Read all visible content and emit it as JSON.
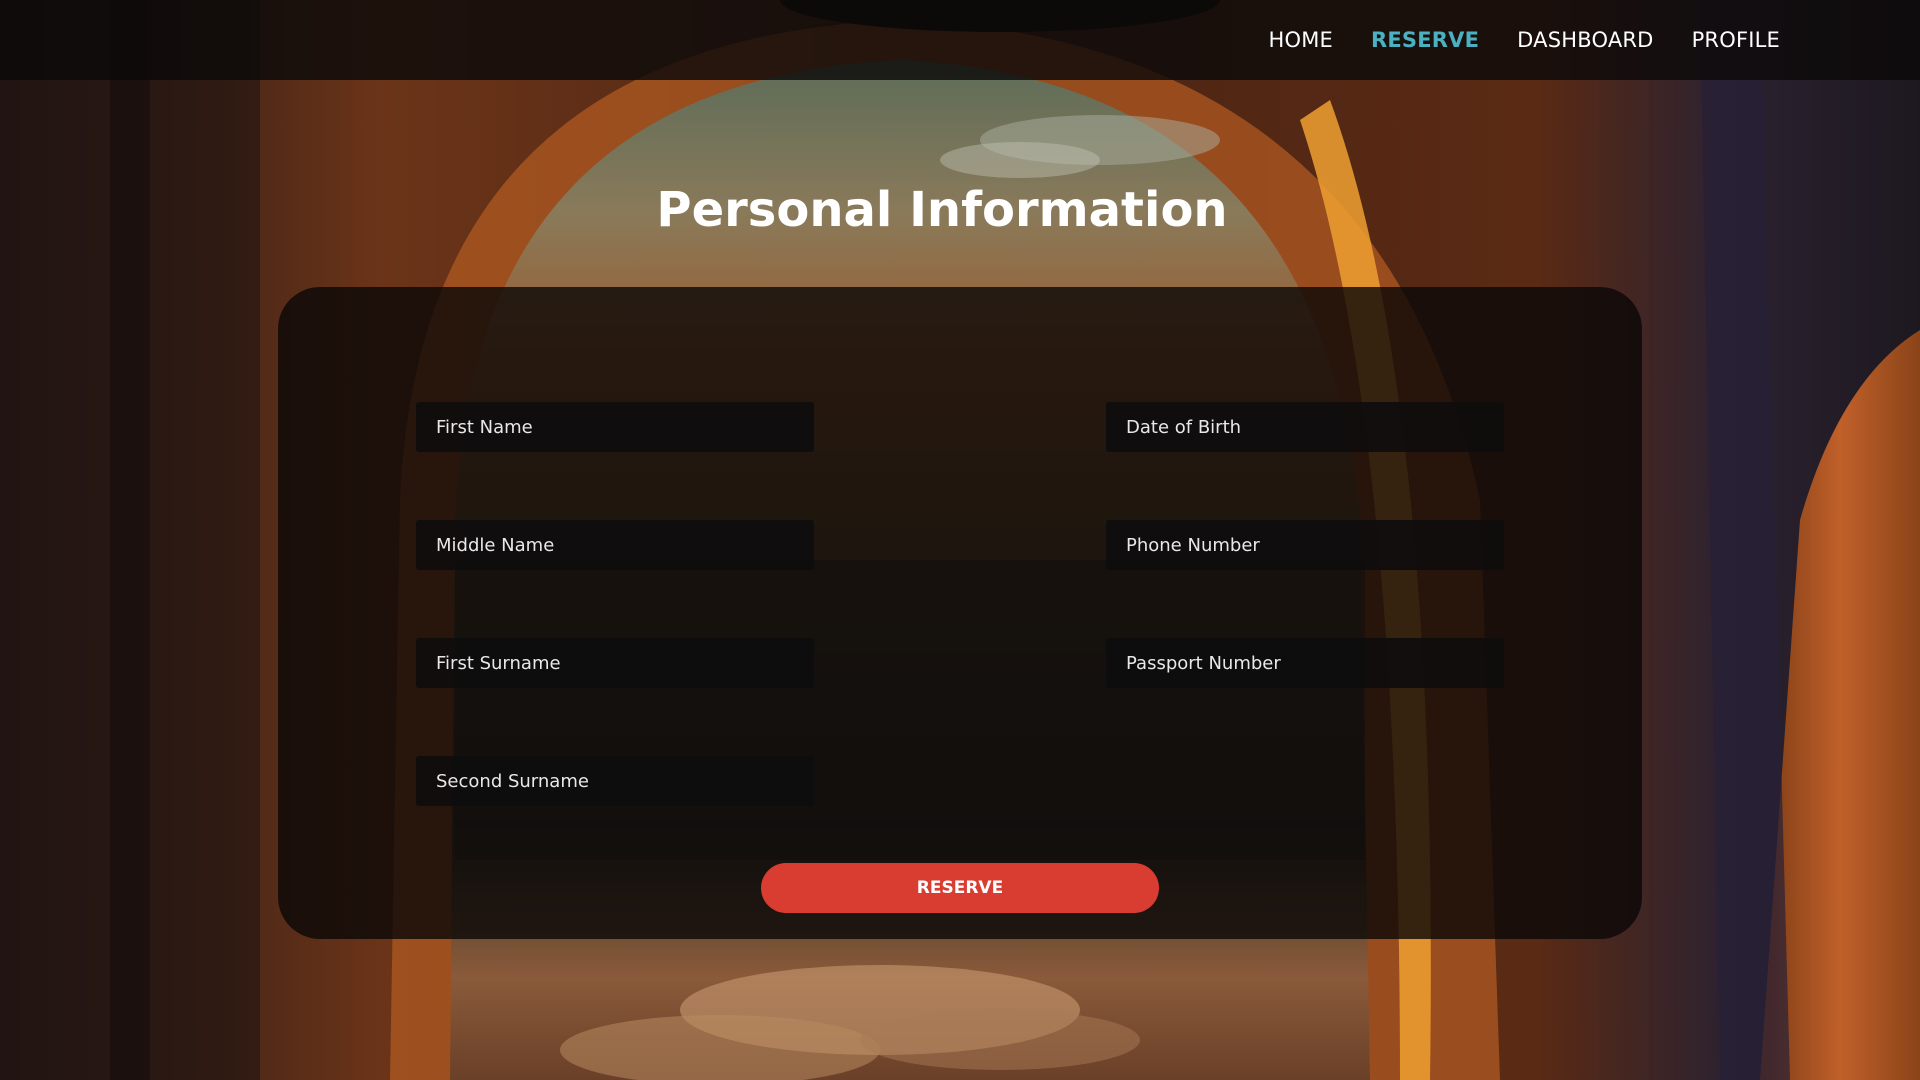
{
  "nav": {
    "items": [
      {
        "label": "HOME",
        "active": false
      },
      {
        "label": "RESERVE",
        "active": true
      },
      {
        "label": "DASHBOARD",
        "active": false
      },
      {
        "label": "PROFILE",
        "active": false
      }
    ]
  },
  "page": {
    "title": "Personal Information"
  },
  "form": {
    "fields": [
      {
        "placeholder": "First Name",
        "value": ""
      },
      {
        "placeholder": "Middle Name",
        "value": ""
      },
      {
        "placeholder": "First Surname",
        "value": ""
      },
      {
        "placeholder": "Second Surname",
        "value": ""
      },
      {
        "placeholder": "Date of Birth",
        "value": ""
      },
      {
        "placeholder": "Phone Number",
        "value": ""
      },
      {
        "placeholder": "Passport Number",
        "value": ""
      }
    ],
    "submit_label": "RESERVE"
  },
  "colors": {
    "accent": "#4ab0c2",
    "button": "#d93c30",
    "navbar_bg": "#0c0a0a",
    "panel_bg": "#0a0808",
    "text": "#ffffff"
  },
  "background": {
    "description_icon": "airplane-window-photo"
  }
}
